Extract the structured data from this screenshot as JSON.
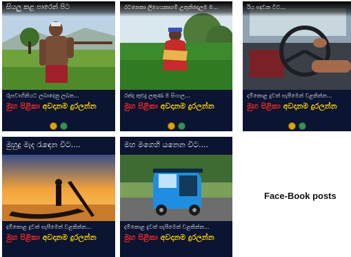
{
  "posts": [
    {
      "title": "සියලු කළ පාරෙන් පිට",
      "slogan": "රුපවාහිනියට ලබාදෙනු ලබන...",
      "brand_left": "මුහ පිළිකා",
      "brand_right": "අවදානම දුරලන්න"
    },
    {
      "title": "රටනෙකා ලිගෙයකාගම් උතුනිදොලම ම...",
      "slogan": "රත්ද කුළුදු ලකුණ ම සිංහල...",
      "brand_left": "මුහ පිළිකා",
      "brand_right": "අවදානම දුරලන්න"
    },
    {
      "title": "රිය පදවන විට...",
      "slogan": "දම්කොළ දුවත් සැපීමෙන් වළකින්න...",
      "brand_left": "මුහ පිළිකා",
      "brand_right": "අවදානම දුරලන්න"
    },
    {
      "title": "මුහුදු මැද රැඳෙන විට....",
      "slogan": "දම්කොළ දුවත් සැපීමෙන් වළකින්න...",
      "brand_left": "මුහ පිළිකා",
      "brand_right": "අවදානම දුරලන්න"
    },
    {
      "title": "මහ මගෙහි යනෙන විට....",
      "slogan": "දම්කොළ දුවත් සැපීමෙන් වළකින්න...",
      "brand_left": "මුහ පිළිකා",
      "brand_right": "අවදානම දුරලන්න"
    }
  ],
  "caption": "Face-Book posts",
  "colors": {
    "panel_bg": "#0b1430",
    "brand_left": "#ff2a2a",
    "brand_right": "#ffd400"
  }
}
